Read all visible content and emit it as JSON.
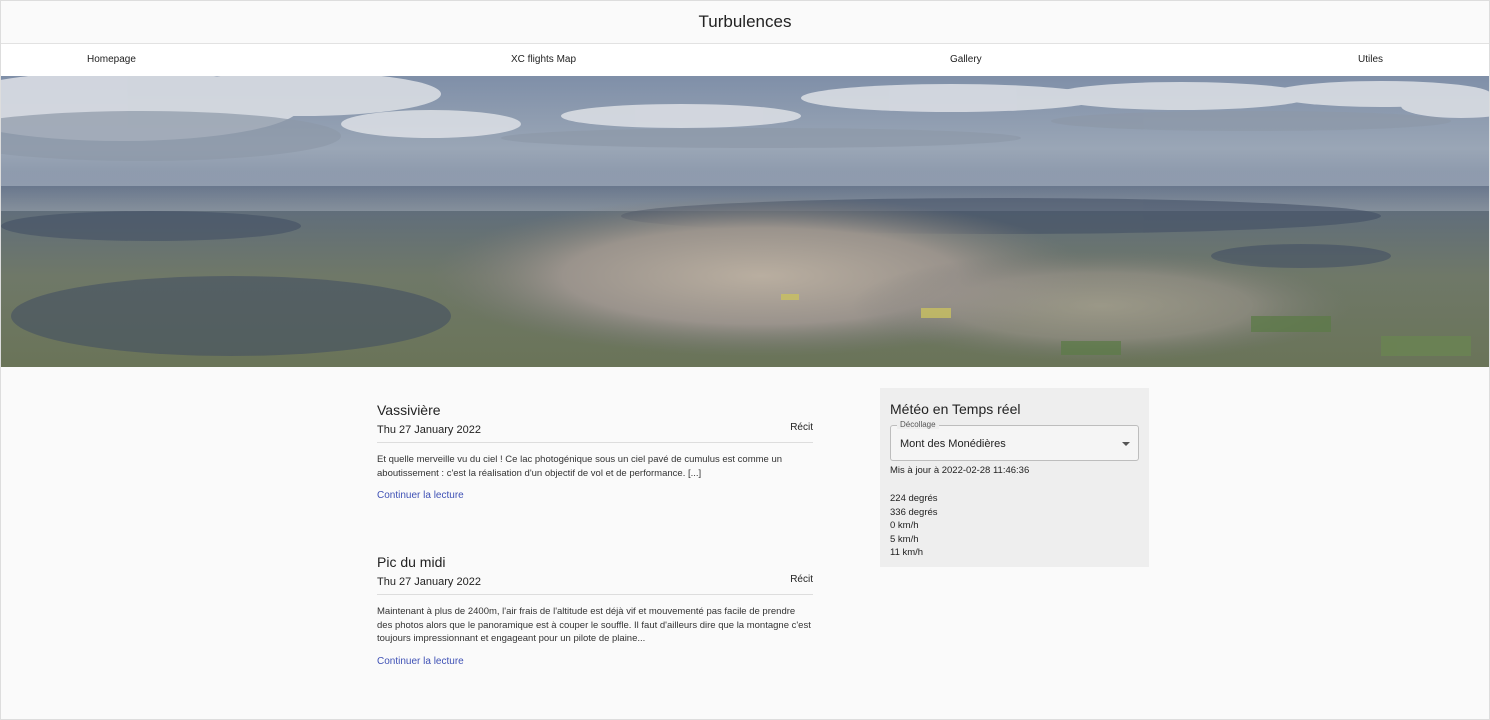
{
  "site": {
    "title": "Turbulences"
  },
  "nav": [
    {
      "label": "Homepage"
    },
    {
      "label": "XC flights Map"
    },
    {
      "label": "Gallery"
    },
    {
      "label": "Utiles"
    }
  ],
  "hero": {
    "icon": "aerial-landscape-photo"
  },
  "posts": [
    {
      "title": "Vassivière",
      "date": "Thu 27 January 2022",
      "category": "Récit",
      "excerpt": "Et quelle merveille vu du ciel ! Ce lac photogénique sous un ciel pavé de cumulus est comme un aboutissement : c'est la réalisation d'un objectif de vol et de performance. [...]",
      "read_more": "Continuer la lecture"
    },
    {
      "title": "Pic du midi",
      "date": "Thu 27 January 2022",
      "category": "Récit",
      "excerpt": "Maintenant à plus de 2400m, l'air frais de l'altitude est déjà vif et mouvementé pas facile de prendre des photos alors que le panoramique est à couper le souffle. Il faut d'ailleurs dire que la montagne c'est toujours impressionnant et engageant pour un pilote de plaine...",
      "read_more": "Continuer la lecture"
    }
  ],
  "weather": {
    "title": "Météo en Temps réel",
    "select_label": "Décollage",
    "select_value": "Mont des Monédières",
    "updated": "Mis à jour à 2022-02-28 11:46:36",
    "readings": [
      "224 degrés",
      "336 degrés",
      "0 km/h",
      "5 km/h",
      "11 km/h"
    ]
  },
  "colors": {
    "link": "#3f51b5",
    "widget_bg": "#eeeeee",
    "page_bg": "#fafafa"
  }
}
